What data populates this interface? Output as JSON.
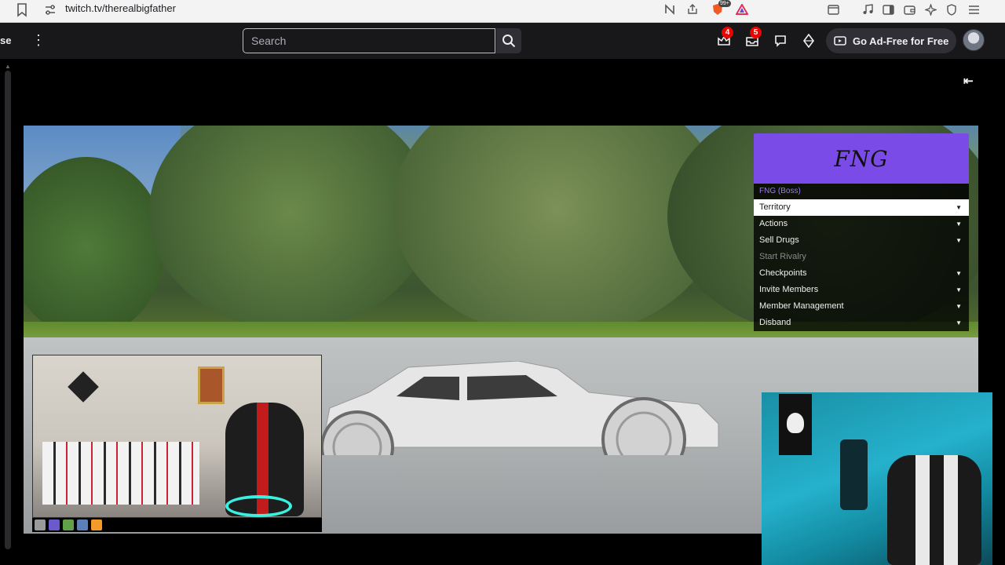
{
  "browser": {
    "url": "twitch.tv/therealbigfather",
    "extension_badge": "99+"
  },
  "nav": {
    "partial_label": "se",
    "search_placeholder": "Search",
    "inbox_badge": "4",
    "whispers_badge": "5",
    "adfree_label": "Go Ad-Free for Free"
  },
  "menu": {
    "title": "FNG",
    "subtitle": "FNG (Boss)",
    "items": [
      {
        "label": "Territory",
        "state": "selected",
        "caret": true
      },
      {
        "label": "Actions",
        "state": "normal",
        "caret": true
      },
      {
        "label": "Sell Drugs",
        "state": "normal",
        "caret": true
      },
      {
        "label": "Start Rivalry",
        "state": "disabled",
        "caret": false
      },
      {
        "label": "Checkpoints",
        "state": "normal",
        "caret": true
      },
      {
        "label": "Invite Members",
        "state": "normal",
        "caret": true
      },
      {
        "label": "Member Management",
        "state": "normal",
        "caret": true
      },
      {
        "label": "Disband",
        "state": "normal",
        "caret": true
      }
    ]
  },
  "colors": {
    "twitch_bg": "#18181b",
    "menu_accent": "#7b4be8",
    "badge_red": "#eb0400"
  }
}
